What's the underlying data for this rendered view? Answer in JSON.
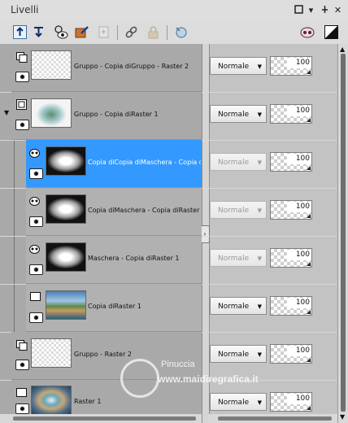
{
  "window": {
    "title": "Livelli",
    "buttons": [
      "restore",
      "menu",
      "pin",
      "close"
    ]
  },
  "toolbar": {
    "tools": [
      {
        "icon": "new-raster-layer-icon",
        "enabled": true
      },
      {
        "icon": "new-vector-layer-icon",
        "enabled": true
      },
      {
        "icon": "visibility-toggle-icon",
        "enabled": true
      },
      {
        "icon": "edit-layer-icon",
        "enabled": true
      },
      {
        "icon": "duplicate-layer-icon",
        "enabled": false
      },
      {
        "icon": "link-layers-icon",
        "enabled": true
      },
      {
        "icon": "lock-layer-icon",
        "enabled": false
      },
      {
        "icon": "delete-layer-icon",
        "enabled": true
      }
    ],
    "right_icons": [
      "mask-icon",
      "invert-icon"
    ]
  },
  "layers": [
    {
      "name": "Gruppo - Copia diGruppo - Raster 2",
      "type": "group",
      "blend": "Normale",
      "opacity": "100",
      "selected": false,
      "child": false,
      "thumb": "transp"
    },
    {
      "name": "Gruppo - Copia diRaster 1",
      "type": "group",
      "blend": "Normale",
      "opacity": "100",
      "selected": false,
      "child": false,
      "thumb": "group1",
      "expanded": true
    },
    {
      "name": "Copia diCopia diMaschera - Copia d",
      "type": "mask",
      "blend": "Normale",
      "opacity": "100",
      "selected": true,
      "child": true,
      "thumb": "mask"
    },
    {
      "name": "Copia diMaschera - Copia diRaster",
      "type": "mask",
      "blend": "Normale",
      "opacity": "100",
      "selected": false,
      "child": true,
      "thumb": "mask"
    },
    {
      "name": "Maschera - Copia diRaster 1",
      "type": "mask",
      "blend": "Normale",
      "opacity": "100",
      "selected": false,
      "child": true,
      "thumb": "mask"
    },
    {
      "name": "Copia diRaster 1",
      "type": "raster",
      "blend": "Normale",
      "opacity": "100",
      "selected": false,
      "child": true,
      "thumb": "scene"
    },
    {
      "name": "Gruppo - Raster 2",
      "type": "group",
      "blend": "Normale",
      "opacity": "100",
      "selected": false,
      "child": false,
      "thumb": "transp"
    },
    {
      "name": "Raster 1",
      "type": "raster",
      "blend": "Normale",
      "opacity": "100",
      "selected": false,
      "child": false,
      "thumb": "raster1"
    }
  ],
  "watermark": {
    "name": "Pinuccia",
    "site": "www.maidiregrafica.it"
  },
  "colors": {
    "selected": "#3399ff",
    "panel": "#c3c3c3",
    "left_column": "#a9a9a9"
  }
}
